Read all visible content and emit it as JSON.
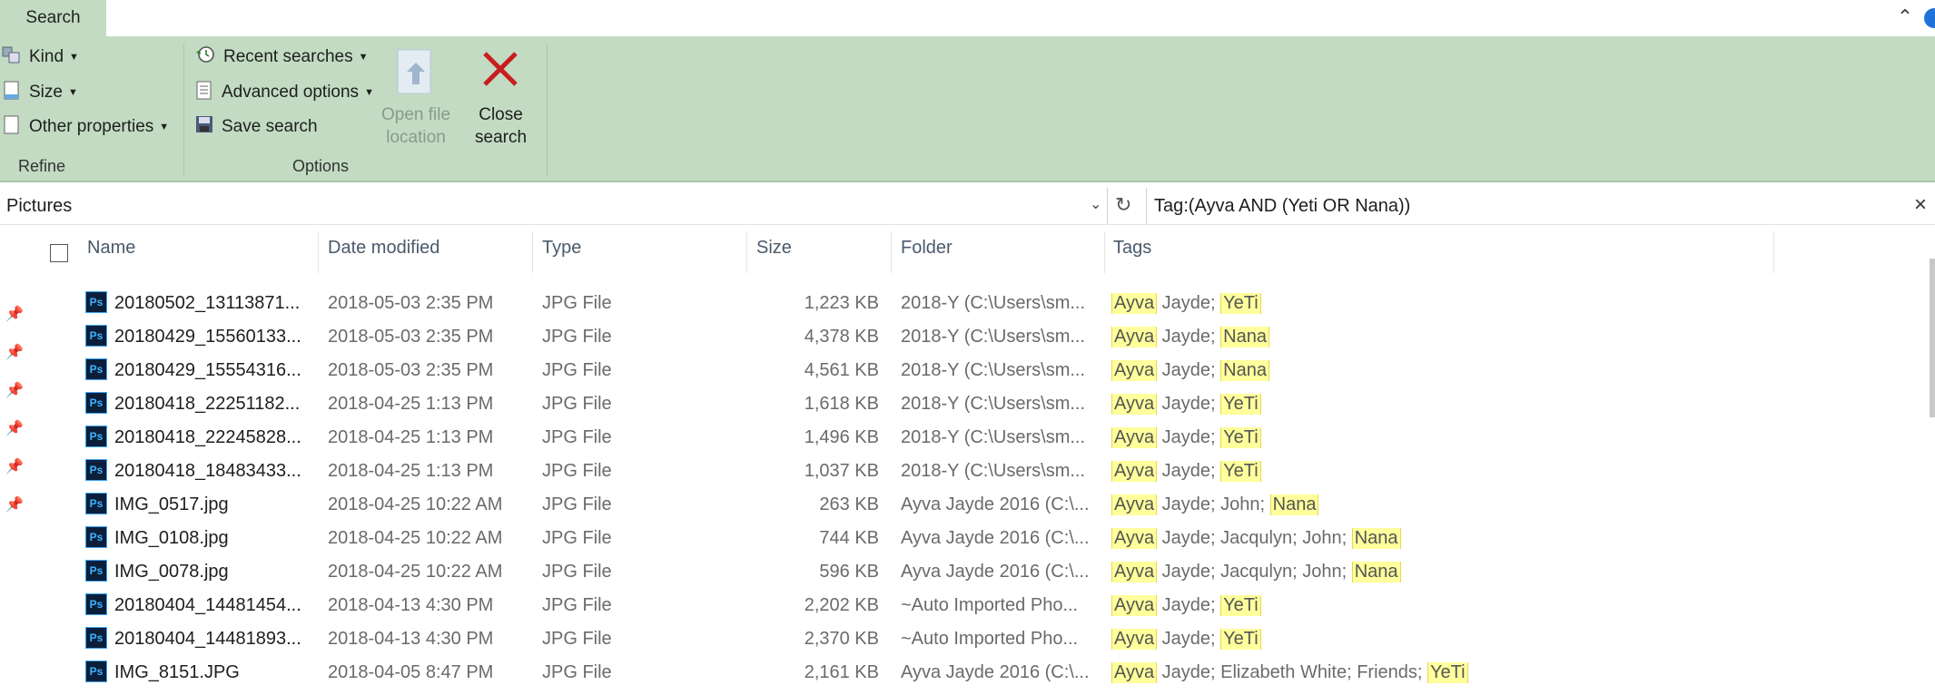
{
  "ribbon_tab": "Search",
  "refine": {
    "kind": "Kind",
    "size": "Size",
    "other": "Other properties",
    "label": "Refine"
  },
  "options": {
    "recent": "Recent searches",
    "advanced": "Advanced options",
    "save": "Save search",
    "label": "Options"
  },
  "open_file_location": [
    "Open file",
    "location"
  ],
  "close_search": [
    "Close",
    "search"
  ],
  "location": "Pictures",
  "search_query": "Tag:(Ayva  AND (Yeti  OR Nana))",
  "columns": [
    "Name",
    "Date modified",
    "Type",
    "Size",
    "Folder",
    "Tags"
  ],
  "rows": [
    {
      "name": "20180502_13113871...",
      "date": "2018-05-03 2:35 PM",
      "type": "JPG File",
      "size": "1,223 KB",
      "folder": "2018-Y (C:\\Users\\sm...",
      "tags": [
        [
          "Ayva",
          true
        ],
        [
          " Jayde; ",
          false
        ],
        [
          "YeTi",
          true
        ]
      ]
    },
    {
      "name": "20180429_15560133...",
      "date": "2018-05-03 2:35 PM",
      "type": "JPG File",
      "size": "4,378 KB",
      "folder": "2018-Y (C:\\Users\\sm...",
      "tags": [
        [
          "Ayva",
          true
        ],
        [
          " Jayde; ",
          false
        ],
        [
          "Nana",
          true
        ]
      ]
    },
    {
      "name": "20180429_15554316...",
      "date": "2018-05-03 2:35 PM",
      "type": "JPG File",
      "size": "4,561 KB",
      "folder": "2018-Y (C:\\Users\\sm...",
      "tags": [
        [
          "Ayva",
          true
        ],
        [
          " Jayde; ",
          false
        ],
        [
          "Nana",
          true
        ]
      ]
    },
    {
      "name": "20180418_22251182...",
      "date": "2018-04-25 1:13 PM",
      "type": "JPG File",
      "size": "1,618 KB",
      "folder": "2018-Y (C:\\Users\\sm...",
      "tags": [
        [
          "Ayva",
          true
        ],
        [
          " Jayde; ",
          false
        ],
        [
          "YeTi",
          true
        ]
      ]
    },
    {
      "name": "20180418_22245828...",
      "date": "2018-04-25 1:13 PM",
      "type": "JPG File",
      "size": "1,496 KB",
      "folder": "2018-Y (C:\\Users\\sm...",
      "tags": [
        [
          "Ayva",
          true
        ],
        [
          " Jayde; ",
          false
        ],
        [
          "YeTi",
          true
        ]
      ]
    },
    {
      "name": "20180418_18483433...",
      "date": "2018-04-25 1:13 PM",
      "type": "JPG File",
      "size": "1,037 KB",
      "folder": "2018-Y (C:\\Users\\sm...",
      "tags": [
        [
          "Ayva",
          true
        ],
        [
          " Jayde; ",
          false
        ],
        [
          "YeTi",
          true
        ]
      ]
    },
    {
      "name": "IMG_0517.jpg",
      "date": "2018-04-25 10:22 AM",
      "type": "JPG File",
      "size": "263 KB",
      "folder": "Ayva Jayde 2016 (C:\\...",
      "tags": [
        [
          "Ayva",
          true
        ],
        [
          " Jayde; John; ",
          false
        ],
        [
          "Nana",
          true
        ]
      ]
    },
    {
      "name": "IMG_0108.jpg",
      "date": "2018-04-25 10:22 AM",
      "type": "JPG File",
      "size": "744 KB",
      "folder": "Ayva Jayde 2016 (C:\\...",
      "tags": [
        [
          "Ayva",
          true
        ],
        [
          " Jayde; Jacqulyn; John; ",
          false
        ],
        [
          "Nana",
          true
        ]
      ]
    },
    {
      "name": "IMG_0078.jpg",
      "date": "2018-04-25 10:22 AM",
      "type": "JPG File",
      "size": "596 KB",
      "folder": "Ayva Jayde 2016 (C:\\...",
      "tags": [
        [
          "Ayva",
          true
        ],
        [
          " Jayde; Jacqulyn; John; ",
          false
        ],
        [
          "Nana",
          true
        ]
      ]
    },
    {
      "name": "20180404_14481454...",
      "date": "2018-04-13 4:30 PM",
      "type": "JPG File",
      "size": "2,202 KB",
      "folder": "~Auto Imported Pho...",
      "tags": [
        [
          "Ayva",
          true
        ],
        [
          " Jayde; ",
          false
        ],
        [
          "YeTi",
          true
        ]
      ]
    },
    {
      "name": "20180404_14481893...",
      "date": "2018-04-13 4:30 PM",
      "type": "JPG File",
      "size": "2,370 KB",
      "folder": "~Auto Imported Pho...",
      "tags": [
        [
          "Ayva",
          true
        ],
        [
          " Jayde; ",
          false
        ],
        [
          "YeTi",
          true
        ]
      ]
    },
    {
      "name": "IMG_8151.JPG",
      "date": "2018-04-05 8:47 PM",
      "type": "JPG File",
      "size": "2,161 KB",
      "folder": "Ayva Jayde 2016 (C:\\...",
      "tags": [
        [
          "Ayva",
          true
        ],
        [
          " Jayde; Elizabeth White; Friends; ",
          false
        ],
        [
          "YeTi",
          true
        ]
      ]
    }
  ]
}
